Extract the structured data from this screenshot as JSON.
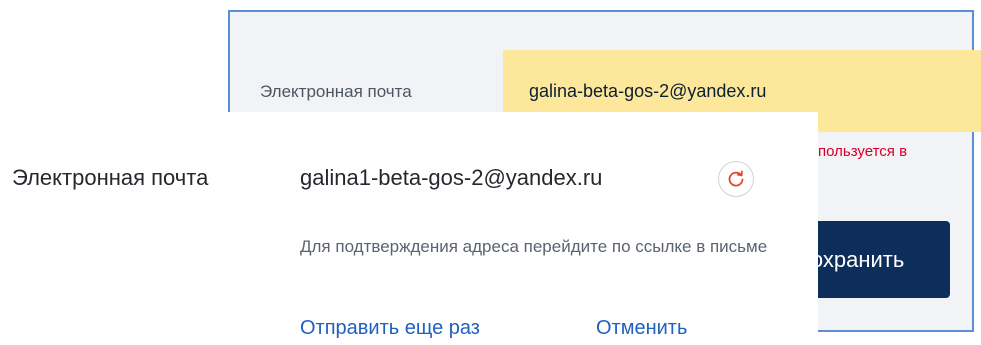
{
  "background_form": {
    "email_label": "Электронная почта",
    "email_value": "galina-beta-gos-2@yandex.ru",
    "error_text": "пользуется в",
    "save_label": "Сохранить",
    "input_bg_color": "#fce79b",
    "error_color": "#d4002b",
    "button_color": "#0d2d5a"
  },
  "email_confirmation": {
    "label": "Электронная почта",
    "email": "galina1-beta-gos-2@yandex.ru",
    "refresh_icon": "refresh-icon",
    "hint": "Для подтверждения адреса перейдите по ссылке в письме",
    "resend_link": "Отправить еще раз",
    "cancel_link": "Отменить",
    "link_color": "#2060bf"
  }
}
